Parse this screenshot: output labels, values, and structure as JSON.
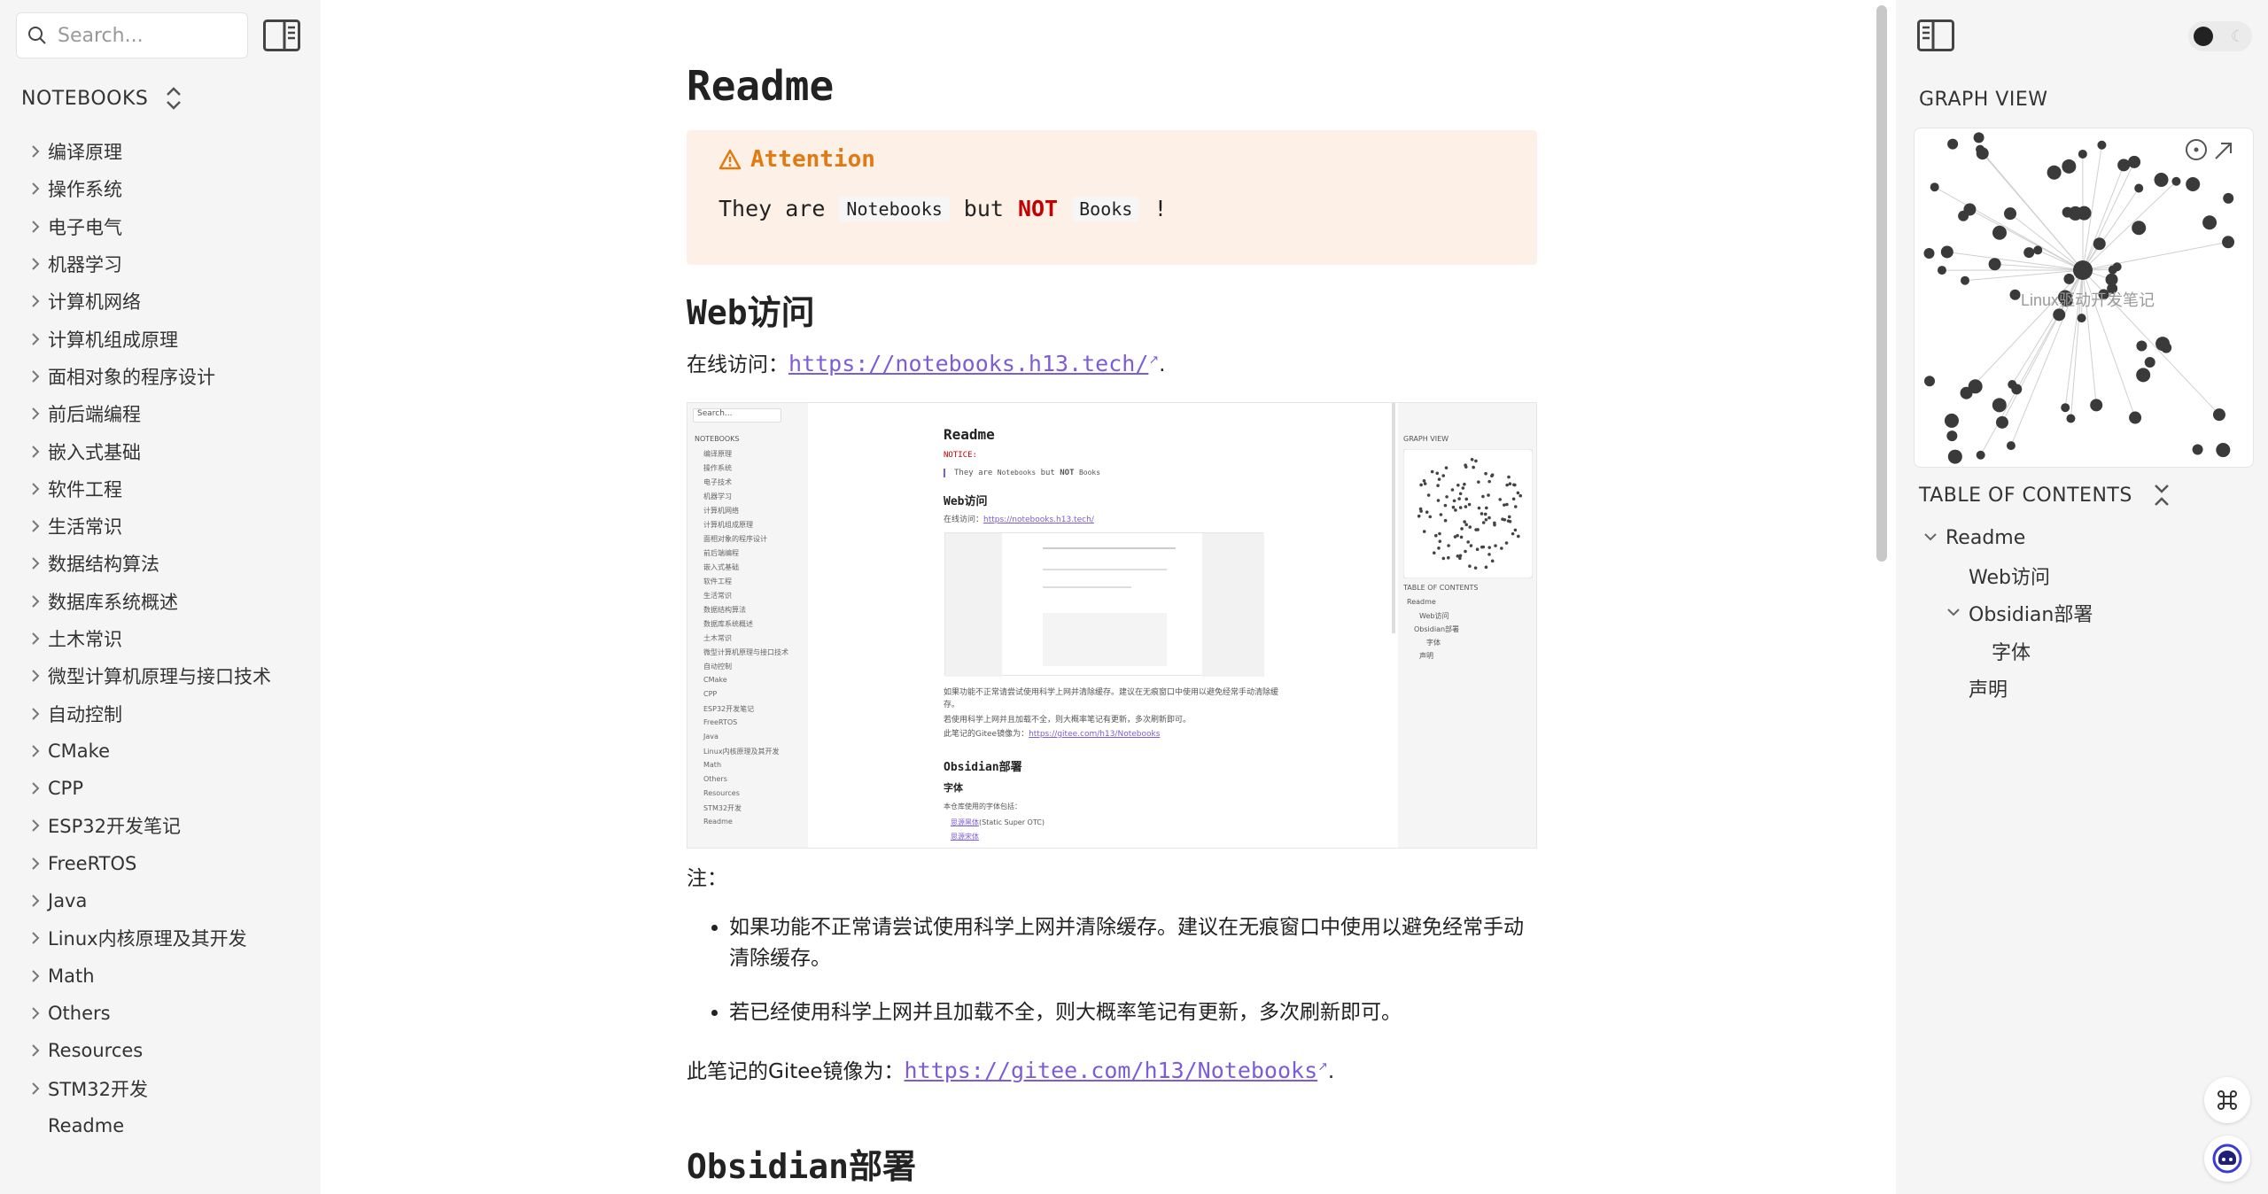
{
  "search": {
    "placeholder": "Search..."
  },
  "notebooks": {
    "header": "NOTEBOOKS",
    "items": [
      {
        "label": "编译原理",
        "folder": true
      },
      {
        "label": "操作系统",
        "folder": true
      },
      {
        "label": "电子电气",
        "folder": true
      },
      {
        "label": "机器学习",
        "folder": true
      },
      {
        "label": "计算机网络",
        "folder": true
      },
      {
        "label": "计算机组成原理",
        "folder": true
      },
      {
        "label": "面相对象的程序设计",
        "folder": true
      },
      {
        "label": "前后端编程",
        "folder": true
      },
      {
        "label": "嵌入式基础",
        "folder": true
      },
      {
        "label": "软件工程",
        "folder": true
      },
      {
        "label": "生活常识",
        "folder": true
      },
      {
        "label": "数据结构算法",
        "folder": true
      },
      {
        "label": "数据库系统概述",
        "folder": true
      },
      {
        "label": "土木常识",
        "folder": true
      },
      {
        "label": "微型计算机原理与接口技术",
        "folder": true
      },
      {
        "label": "自动控制",
        "folder": true
      },
      {
        "label": "CMake",
        "folder": true
      },
      {
        "label": "CPP",
        "folder": true
      },
      {
        "label": "ESP32开发笔记",
        "folder": true
      },
      {
        "label": "FreeRTOS",
        "folder": true
      },
      {
        "label": "Java",
        "folder": true
      },
      {
        "label": "Linux内核原理及其开发",
        "folder": true
      },
      {
        "label": "Math",
        "folder": true
      },
      {
        "label": "Others",
        "folder": true
      },
      {
        "label": "Resources",
        "folder": true
      },
      {
        "label": "STM32开发",
        "folder": true
      },
      {
        "label": "Readme",
        "folder": false
      }
    ]
  },
  "article": {
    "title": "Readme",
    "callout": {
      "title": "Attention",
      "text1": "They are",
      "code1": "Notebooks",
      "text2": "but",
      "not": "NOT",
      "code2": "Books",
      "text3": "!"
    },
    "web_heading": "Web访问",
    "online_label": "在线访问：",
    "online_url": "https://notebooks.h13.tech/",
    "note_label": "注：",
    "notes": [
      "如果功能不正常请尝试使用科学上网并清除缓存。建议在无痕窗口中使用以避免经常手动清除缓存。",
      "若已经使用科学上网并且加载不全，则大概率笔记有更新，多次刷新即可。"
    ],
    "gitee_label": "此笔记的Gitee镜像为：",
    "gitee_url": "https://gitee.com/h13/Notebooks",
    "obsidian_heading": "Obsidian部署",
    "period": "."
  },
  "screenshot": {
    "search": "Search...",
    "notebooks": "NOTEBOOKS",
    "title": "Readme",
    "notice": "NOTICE:",
    "quote_a": "They are",
    "quote_code1": "Notebooks",
    "quote_b": "but",
    "quote_not": "NOT",
    "quote_code2": "Books",
    "web": "Web访问",
    "online": "在线访问：",
    "online_url": "https://notebooks.h13.tech/",
    "graph": "GRAPH VIEW",
    "toc": "TABLE OF CONTENTS",
    "toc_items": [
      "Readme",
      "Web访问",
      "Obsidian部署",
      "字体",
      "声明"
    ],
    "note1": "如果功能不正常请尝试使用科学上网并清除缓存。建议在无痕窗口中使用以避免经常手动清除缓存。",
    "note2": "若使用科学上网并且加载不全，则大概率笔记有更新，多次刷新即可。",
    "gitee_label": "此笔记的Gitee镜像为：",
    "gitee_url": "https://gitee.com/h13/Notebooks",
    "obsidian": "Obsidian部署",
    "font": "字体",
    "font_intro": "本仓库使用的字体包括：",
    "font_item1": "思源黑体",
    "font_item1_suffix": "(Static Super OTC)",
    "font_item2": "思源宋体",
    "side_items": [
      "编译原理",
      "操作系统",
      "电子技术",
      "机器学习",
      "计算机网络",
      "计算机组成原理",
      "面相对象的程序设计",
      "前后端编程",
      "嵌入式基础",
      "软件工程",
      "生活常识",
      "数据结构算法",
      "数据库系统概述",
      "土木常识",
      "微型计算机原理与接口技术",
      "自动控制",
      "CMake",
      "CPP",
      "ESP32开发笔记",
      "FreeRTOS",
      "Java",
      "Linux内核原理及其开发",
      "Math",
      "Others",
      "Resources",
      "STM32开发",
      "Readme"
    ]
  },
  "right_panel": {
    "graph_heading": "GRAPH VIEW",
    "graph_labels": [
      "Linux驱动开发笔记"
    ],
    "toc_heading": "TABLE OF CONTENTS",
    "toc": [
      "Readme",
      "Web访问",
      "Obsidian部署",
      "字体",
      "声明"
    ]
  },
  "colors": {
    "accent": "#7c5cd9",
    "callout_bg": "#fdf0e6",
    "callout_title": "#e07a12",
    "not": "#c40000"
  }
}
